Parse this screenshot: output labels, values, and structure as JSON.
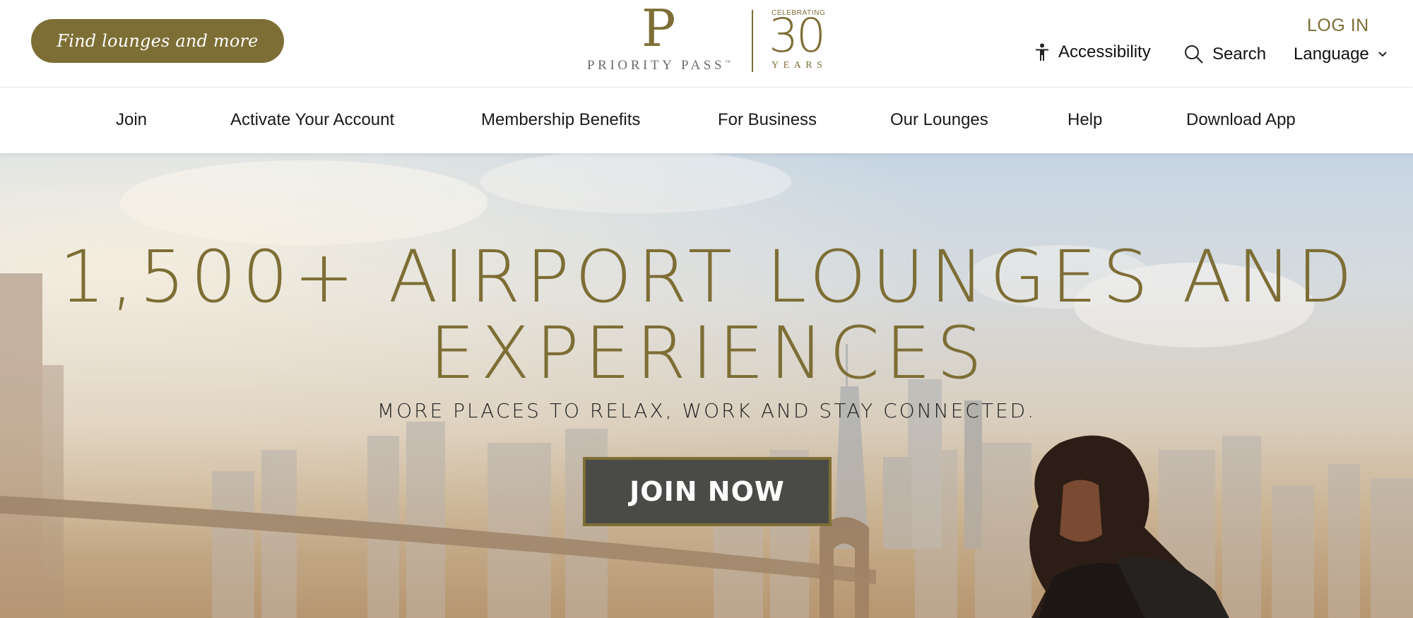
{
  "header": {
    "find_label": "Find lounges and more",
    "logo": {
      "letter": "P",
      "name": "PRIORITY PASS",
      "trademark": "™",
      "celebrating": "CELEBRATING",
      "number": "30",
      "years": "YEARS"
    },
    "login_label": "LOG IN",
    "accessibility_label": "Accessibility",
    "search_label": "Search",
    "language_label": "Language"
  },
  "nav": {
    "items": [
      {
        "label": "Join"
      },
      {
        "label": "Activate Your Account"
      },
      {
        "label": "Membership Benefits"
      },
      {
        "label": "For Business"
      },
      {
        "label": "Our Lounges"
      },
      {
        "label": "Help"
      },
      {
        "label": "Download App"
      }
    ]
  },
  "hero": {
    "title_line1": "1,500+ AIRPORT LOUNGES AND",
    "title_line2": "EXPERIENCES",
    "subtitle": "MORE PLACES TO RELAX, WORK AND STAY CONNECTED.",
    "cta_label": "JOIN NOW"
  },
  "colors": {
    "brand_gold": "#7d6e35",
    "cta_background": "#4a4a47",
    "text_dark": "#1a1a1a"
  },
  "icons": {
    "accessibility": "accessibility-person-icon",
    "search": "search-icon",
    "language": "chevron-down-icon"
  }
}
